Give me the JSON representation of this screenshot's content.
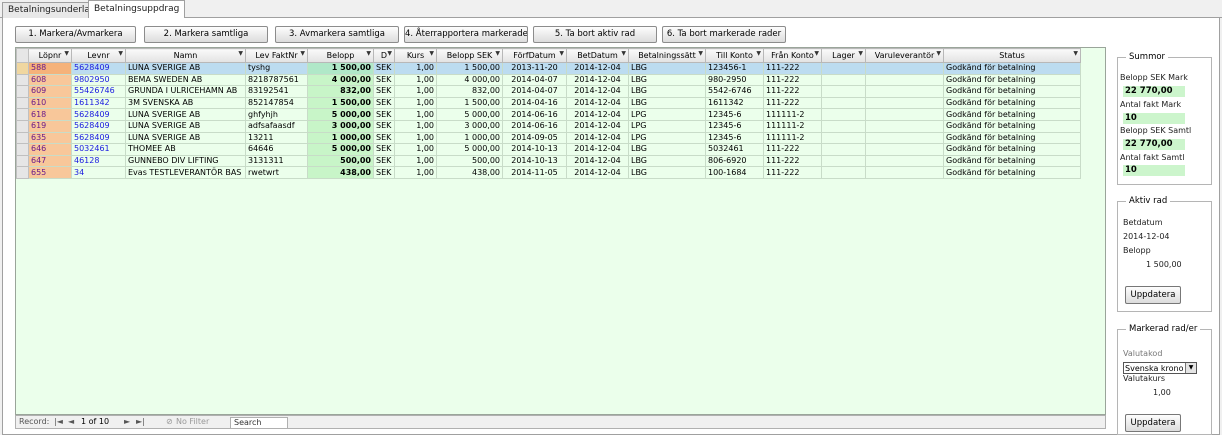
{
  "tabs": [
    {
      "label": "Betalningsunderlag"
    },
    {
      "label": "Betalningsuppdrag"
    }
  ],
  "toolbar": {
    "buttons": [
      "1. Markera/Avmarkera",
      "2. Markera samtliga",
      "3. Avmarkera samtliga",
      "4. Återrapportera markerade",
      "5. Ta bort aktiv rad",
      "6. Ta bort markerade rader"
    ]
  },
  "grid": {
    "columns": [
      "Löpnr",
      "Levnr",
      "Namn",
      "Lev FaktNr",
      "Belopp",
      "D",
      "Kurs",
      "Belopp SEK",
      "FörfDatum",
      "BetDatum",
      "Betalningssätt",
      "Till Konto",
      "Från Konto",
      "Lager",
      "Varuleverantör",
      "Status"
    ],
    "rows": [
      [
        "588",
        "5628409",
        "LUNA SVERIGE AB",
        "tyshg",
        "1 500,00",
        "SEK",
        "1,00",
        "1 500,00",
        "2013-11-20",
        "2014-12-04",
        "LBG",
        "123456-1",
        "111-222",
        "",
        "",
        "Godkänd för betalning"
      ],
      [
        "608",
        "9802950",
        "BEMA SWEDEN AB",
        "8218787561",
        "4 000,00",
        "SEK",
        "1,00",
        "4 000,00",
        "2014-04-07",
        "2014-12-04",
        "LBG",
        "980-2950",
        "111-222",
        "",
        "",
        "Godkänd för betalning"
      ],
      [
        "609",
        "55426746",
        "GRUNDA I ULRICEHAMN AB",
        "83192541",
        "832,00",
        "SEK",
        "1,00",
        "832,00",
        "2014-04-07",
        "2014-12-04",
        "LBG",
        "5542-6746",
        "111-222",
        "",
        "",
        "Godkänd för betalning"
      ],
      [
        "610",
        "1611342",
        "3M SVENSKA AB",
        "852147854",
        "1 500,00",
        "SEK",
        "1,00",
        "1 500,00",
        "2014-04-16",
        "2014-12-04",
        "LBG",
        "1611342",
        "111-222",
        "",
        "",
        "Godkänd för betalning"
      ],
      [
        "618",
        "5628409",
        "LUNA SVERIGE AB",
        "ghfyhjh",
        "5 000,00",
        "SEK",
        "1,00",
        "5 000,00",
        "2014-06-16",
        "2014-12-04",
        "LPG",
        "12345-6",
        "111111-2",
        "",
        "",
        "Godkänd för betalning"
      ],
      [
        "619",
        "5628409",
        "LUNA SVERIGE AB",
        "adfsafaasdf",
        "3 000,00",
        "SEK",
        "1,00",
        "3 000,00",
        "2014-06-16",
        "2014-12-04",
        "LPG",
        "12345-6",
        "111111-2",
        "",
        "",
        "Godkänd för betalning"
      ],
      [
        "635",
        "5628409",
        "LUNA SVERIGE AB",
        "13211",
        "1 000,00",
        "SEK",
        "1,00",
        "1 000,00",
        "2014-09-05",
        "2014-12-04",
        "LPG",
        "12345-6",
        "111111-2",
        "",
        "",
        "Godkänd för betalning"
      ],
      [
        "646",
        "5032461",
        "THOMEE AB",
        "64646",
        "5 000,00",
        "SEK",
        "1,00",
        "5 000,00",
        "2014-10-13",
        "2014-12-04",
        "LBG",
        "5032461",
        "111-222",
        "",
        "",
        "Godkänd för betalning"
      ],
      [
        "647",
        "46128",
        "GUNNEBO DIV LIFTING",
        "3131311",
        "500,00",
        "SEK",
        "1,00",
        "500,00",
        "2014-10-13",
        "2014-12-04",
        "LBG",
        "806-6920",
        "111-222",
        "",
        "",
        "Godkänd för betalning"
      ],
      [
        "655",
        "34",
        "Evas TESTLEVERANTÖR BAS",
        "rwetwrt",
        "438,00",
        "SEK",
        "1,00",
        "438,00",
        "2014-11-05",
        "2014-12-04",
        "LBG",
        "100-1684",
        "111-222",
        "",
        "",
        "Godkänd för betalning"
      ]
    ]
  },
  "navbar": {
    "record_label": "Record:",
    "position": "1 of 10",
    "filter": "No Filter",
    "search": "Search",
    "first": "|◄",
    "prev": "◄",
    "next": "►",
    "last": "►|"
  },
  "summor": {
    "title": "Summor",
    "belopp_mark_label": "Belopp SEK Mark",
    "belopp_mark": "22 770,00",
    "antal_mark_label": "Antal fakt Mark",
    "antal_mark": "10",
    "belopp_samtl_label": "Belopp SEK Samtl",
    "belopp_samtl": "22 770,00",
    "antal_samtl_label": "Antal fakt Samtl",
    "antal_samtl": "10"
  },
  "aktiv_rad": {
    "title": "Aktiv rad",
    "betdatum_label": "Betdatum",
    "betdatum": "2014-12-04",
    "belopp_label": "Belopp",
    "belopp": "1 500,00",
    "button": "Uppdatera"
  },
  "markerad": {
    "title": "Markerad rad/er",
    "valutakod_label": "Valutakod",
    "valutakod": "Svenska kronor",
    "valutakurs_label": "Valutakurs",
    "valutakurs": "1,00",
    "button": "Uppdatera"
  }
}
